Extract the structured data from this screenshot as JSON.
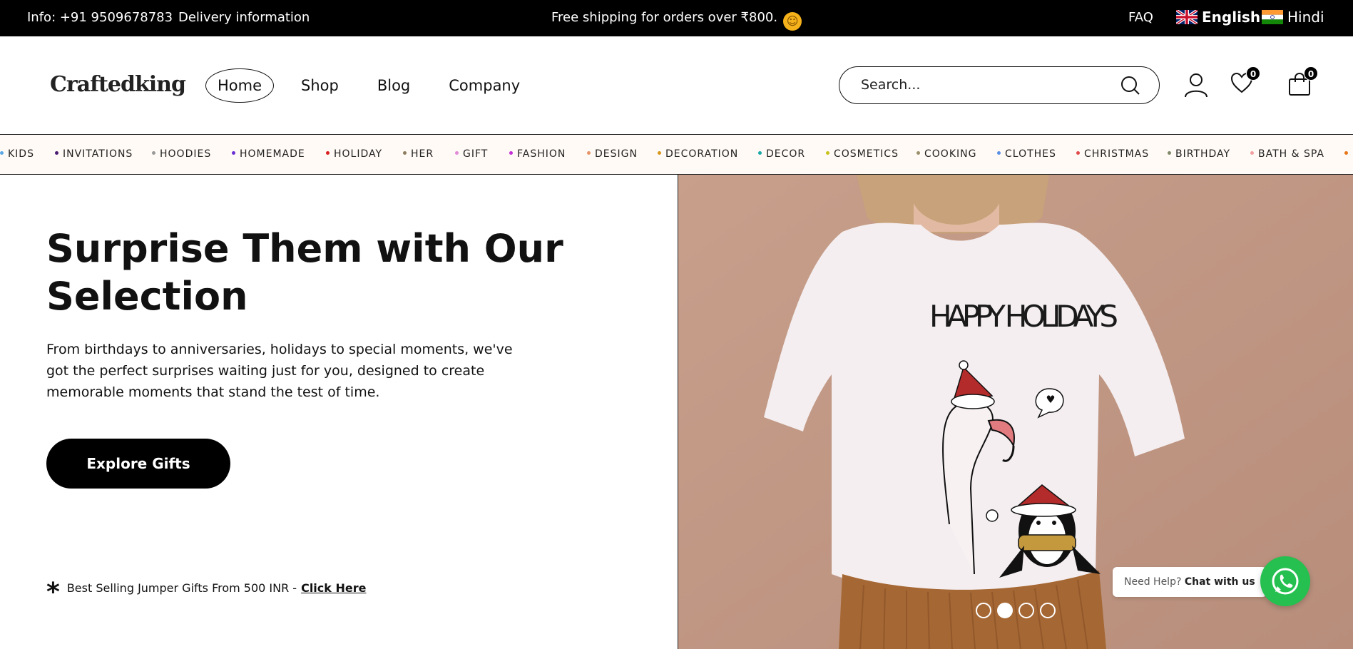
{
  "topbar": {
    "info": "Info: +91 9509678783",
    "delivery": "Delivery information",
    "promo": "Free shipping for orders over ₹800.",
    "faq": "FAQ",
    "lang_english": "English",
    "lang_hindi": "Hindi"
  },
  "header": {
    "logo": "Craftedking",
    "nav": [
      "Home",
      "Shop",
      "Blog",
      "Company"
    ],
    "search_placeholder": "Search...",
    "wishlist_count": "0",
    "cart_count": "0"
  },
  "categories": [
    {
      "label": "KIDS",
      "color": "#5aa9e6"
    },
    {
      "label": "INVITATIONS",
      "color": "#4b1a73"
    },
    {
      "label": "HOODIES",
      "color": "#999999"
    },
    {
      "label": "HOMEMADE",
      "color": "#6a2fd3"
    },
    {
      "label": "HOLIDAY",
      "color": "#d81e1e"
    },
    {
      "label": "HER",
      "color": "#8b7d5e"
    },
    {
      "label": "GIFT",
      "color": "#e08ad8"
    },
    {
      "label": "FASHION",
      "color": "#c42fd8"
    },
    {
      "label": "DESIGN",
      "color": "#e6946a"
    },
    {
      "label": "DECORATION",
      "color": "#d8961a"
    },
    {
      "label": "DECOR",
      "color": "#1aa7a7"
    },
    {
      "label": "COSMETICS",
      "color": "#c8c21a"
    },
    {
      "label": "COOKING",
      "color": "#9a8f6a"
    },
    {
      "label": "CLOTHES",
      "color": "#5a8fe6"
    },
    {
      "label": "CHRISTMAS",
      "color": "#e04a4a"
    },
    {
      "label": "BIRTHDAY",
      "color": "#7f8a6a"
    },
    {
      "label": "BATH & SPA",
      "color": "#f0a0a0"
    }
  ],
  "hero": {
    "title": "Surprise Them with Our Selection",
    "description": "From birthdays to anniversaries, holidays to special moments, we've got the perfect surprises waiting just for you, designed to create memorable moments that stand the test of time.",
    "cta": "Explore Gifts",
    "promo_text": "Best Selling Jumper Gifts From 500 INR -",
    "promo_link": "Click Here",
    "shirt_text": "HAPPY HOLIDAYS"
  },
  "slider": {
    "count": 4,
    "active": 2
  },
  "chat": {
    "prefix": "Need Help?",
    "label": "Chat with us"
  },
  "colors": {
    "topbar_bg": "#000000",
    "hero_photo_bg": "#c9a18e",
    "whatsapp": "#25c04f"
  }
}
